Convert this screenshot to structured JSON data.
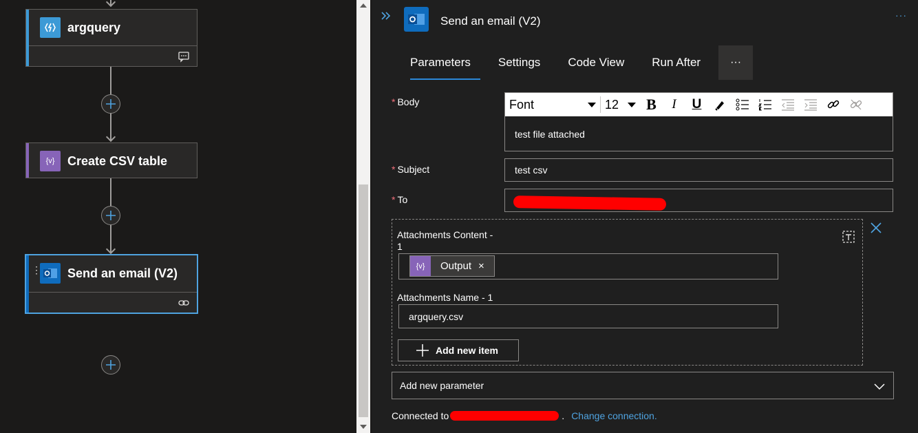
{
  "canvas": {
    "nodes": [
      {
        "title": "argquery",
        "icon": "function-icon",
        "accent": "#3c9ad6"
      },
      {
        "title": "Create CSV table",
        "icon": "data-operation-icon",
        "accent": "#8764b8"
      },
      {
        "title": "Send an email (V2)",
        "icon": "outlook-icon",
        "accent": "#0f6cbd"
      }
    ]
  },
  "panel": {
    "title": "Send an email (V2)",
    "more": "···",
    "tabs": [
      "Parameters",
      "Settings",
      "Code View",
      "Run After"
    ],
    "tab_more": "···",
    "body": {
      "label": "Body",
      "required": "*",
      "font": "Font",
      "font_size": "12",
      "value": "test file attached"
    },
    "subject": {
      "label": "Subject",
      "required": "*",
      "value": "test csv"
    },
    "to": {
      "label": "To",
      "required": "*"
    },
    "attachments": {
      "content_label_1": "Attachments Content -",
      "content_label_2": "1",
      "token": "Output",
      "token_remove": "×",
      "name_label": "Attachments Name - 1",
      "name_value": "argquery.csv",
      "add_item": "Add new item"
    },
    "add_parameter": "Add new parameter",
    "connection": {
      "prefix": "Connected to",
      "suffix": ".",
      "change": "Change connection."
    }
  },
  "colors": {
    "accent_blue": "#2b88d8",
    "link": "#4fa3e0",
    "required": "#f1707b",
    "token_purple": "#8764b8"
  }
}
